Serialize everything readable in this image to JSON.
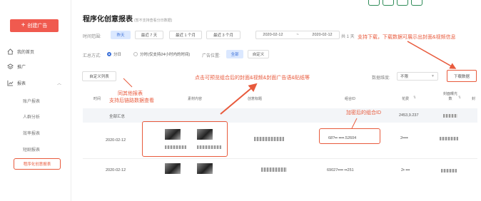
{
  "sidebar": {
    "create_label": "创建广告",
    "nav": [
      {
        "label": "我的首页"
      },
      {
        "label": "推广"
      },
      {
        "label": "报表"
      }
    ],
    "sub_items": [
      "账户报表",
      "人群分析",
      "效率报表",
      "短剧报表"
    ],
    "active_item": "程序化创意报表"
  },
  "header": {
    "title": "程序化创意报表",
    "title_note": "(暂不支持查看分日数据)"
  },
  "filters": {
    "time_label": "时间范围:",
    "time_buttons": [
      "昨天",
      "最近 7 天",
      "最近 1 个月",
      "最近 3 个月"
    ],
    "date_start": "2020-02-12",
    "date_sep": "~",
    "date_end": "2020-02-12",
    "range_suffix": "共 1 天",
    "summary_label": "汇总方式:",
    "summary_opt1": "分日",
    "summary_opt2": "分时(仅支持24小时内的时间)",
    "placement_label": "广告位置:",
    "placement_buttons": [
      "全部",
      "自定义"
    ]
  },
  "toolbar": {
    "custom_columns": "自定义列表",
    "dimension_label": "数据维度:",
    "dimension_value": "不限",
    "download": "下载数据"
  },
  "table": {
    "headers": [
      "时间",
      "素材内容",
      "创意标题",
      "组合ID",
      "花费",
      "封面曝光数",
      "封"
    ],
    "total_label": "全部汇总",
    "total_cost": "2453,9.237",
    "rows": [
      {
        "date": "2020-02-12",
        "combo_id": "68?▪▪ ▪▪▪▪.52604",
        "cost": "2▪▪▪▪"
      },
      {
        "date": "2020-02-12",
        "combo_id": "69027▪▪▪▪ ▪▪251",
        "cost": "2▪ ▪▪▪"
      }
    ]
  },
  "annotations": {
    "top_right": "支持下载，下载数据可展示出封面&视频信息",
    "middle": "点击可预览组合后的封面&视频&封面广告语&贴纸等",
    "left_line1": "同其他报表",
    "left_line2": "支持后链路数据查看",
    "combo": "加密后的组合ID"
  },
  "colors": {
    "accent": "#e85a3c",
    "create_button": "#f05a4f",
    "active_blue": "#3a6fd8"
  }
}
